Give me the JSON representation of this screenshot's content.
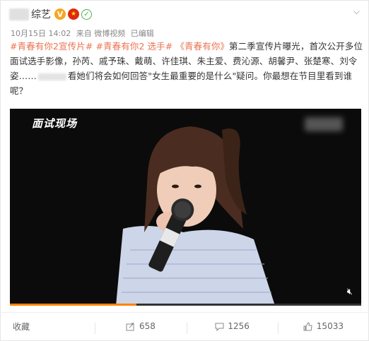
{
  "post": {
    "username": "综艺",
    "meta": {
      "date": "10月15日 14:02",
      "source": "来自 微博视频",
      "edited": "已编辑"
    },
    "content": {
      "tag1": "#青春有你2宣传片#",
      "tag2": "#青春有你2 选手#",
      "tag3": "《青春有你》",
      "text_part1": "第二季宣传片曝光，首次公开多位面试选手影像，孙芮、戚予珠、戴萌、许佳琪、朱主爱、费沁源、胡馨尹、张楚寒、刘令姿……",
      "text_part2": "看她们将会如何回答\"女生最重要的是什么\"疑问。你最想在节目里看到谁呢？"
    },
    "video": {
      "label": "面试现场",
      "progress": 0.36
    }
  },
  "actions": {
    "favorite": "收藏",
    "share": "658",
    "comment": "1256",
    "like": "15033"
  }
}
